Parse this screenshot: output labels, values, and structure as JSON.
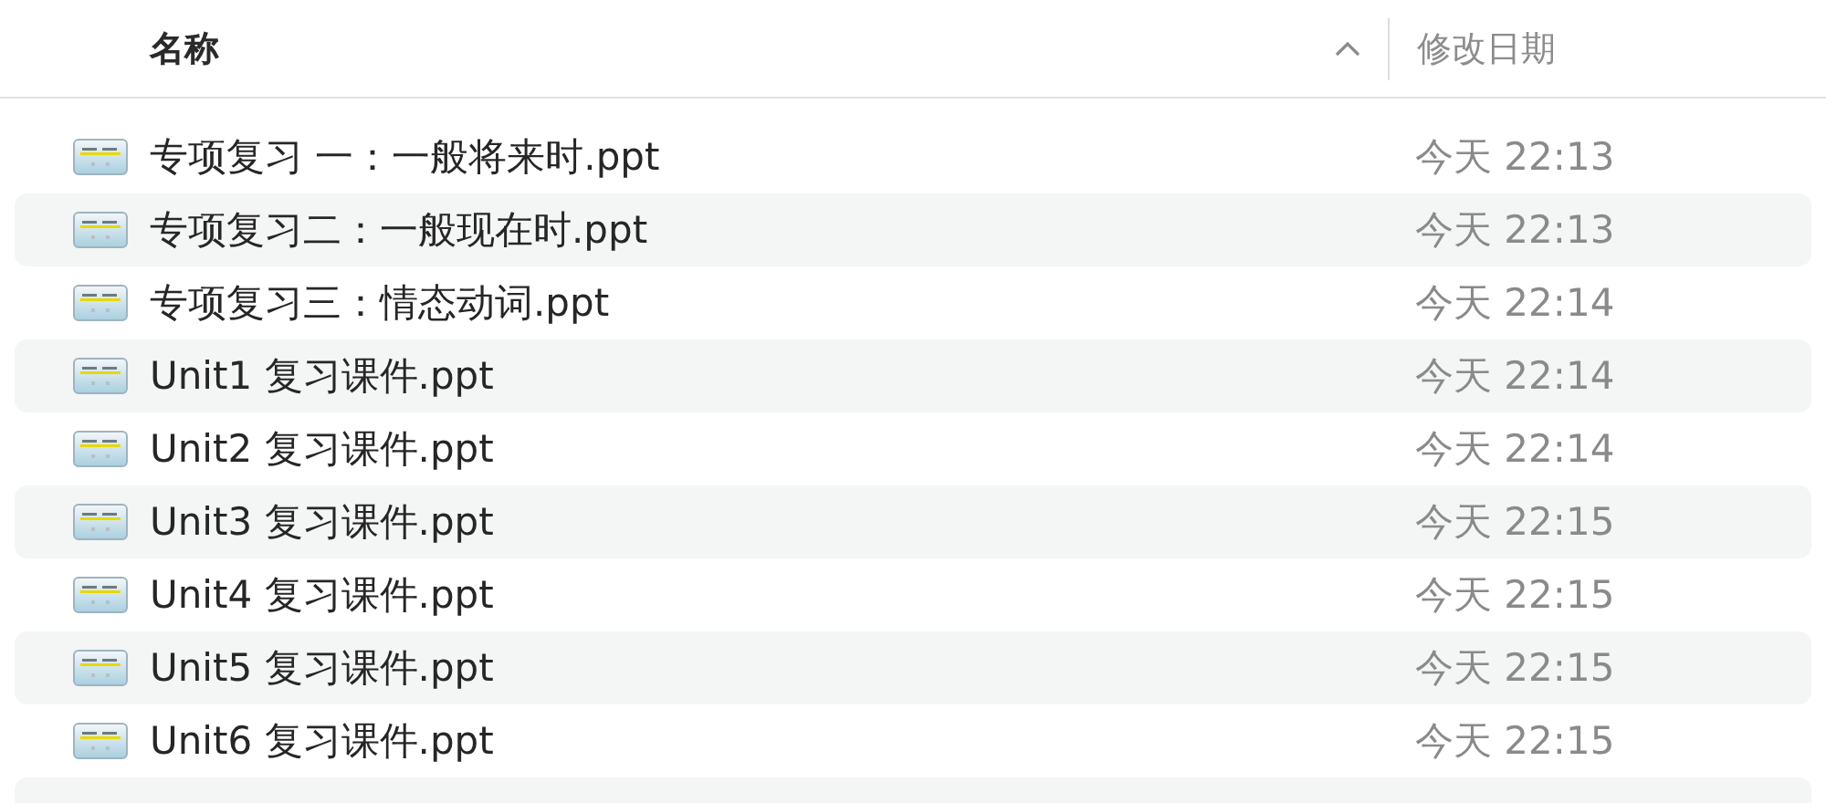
{
  "columns": [
    {
      "label": "名称",
      "sorted": true
    },
    {
      "label": "修改日期",
      "sorted": false
    }
  ],
  "files": [
    {
      "name": "专项复习 一：一般将来时.ppt",
      "modified": "今天 22:13"
    },
    {
      "name": "专项复习二：一般现在时.ppt",
      "modified": "今天 22:13"
    },
    {
      "name": "专项复习三：情态动词.ppt",
      "modified": "今天 22:14"
    },
    {
      "name": "Unit1 复习课件.ppt",
      "modified": "今天 22:14"
    },
    {
      "name": "Unit2 复习课件.ppt",
      "modified": "今天 22:14"
    },
    {
      "name": "Unit3 复习课件.ppt",
      "modified": "今天 22:15"
    },
    {
      "name": "Unit4 复习课件.ppt",
      "modified": "今天 22:15"
    },
    {
      "name": "Unit5 复习课件.ppt",
      "modified": "今天 22:15"
    },
    {
      "name": "Unit6 复习课件.ppt",
      "modified": "今天 22:15"
    }
  ]
}
